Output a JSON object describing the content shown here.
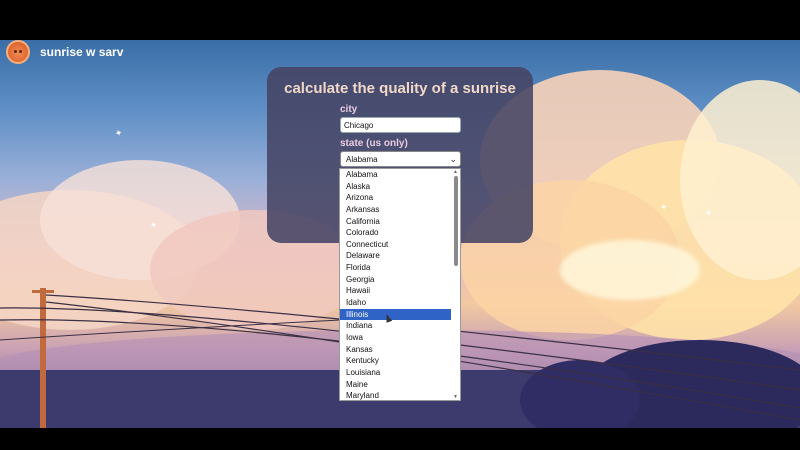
{
  "app": {
    "brand": "sunrise w sarv",
    "logo_icon": "sun-face-icon"
  },
  "form": {
    "title": "calculate the quality of a sunrise",
    "city_label": "city",
    "city_value": "Chicago",
    "state_label": "state (us only)",
    "state_selected": "Alabama"
  },
  "dropdown": {
    "options": [
      "Alabama",
      "Alaska",
      "Arizona",
      "Arkansas",
      "California",
      "Colorado",
      "Connecticut",
      "Delaware",
      "Florida",
      "Georgia",
      "Hawaii",
      "Idaho",
      "Illinois",
      "Indiana",
      "Iowa",
      "Kansas",
      "Kentucky",
      "Louisiana",
      "Maine",
      "Maryland"
    ],
    "highlighted": "Illinois"
  }
}
